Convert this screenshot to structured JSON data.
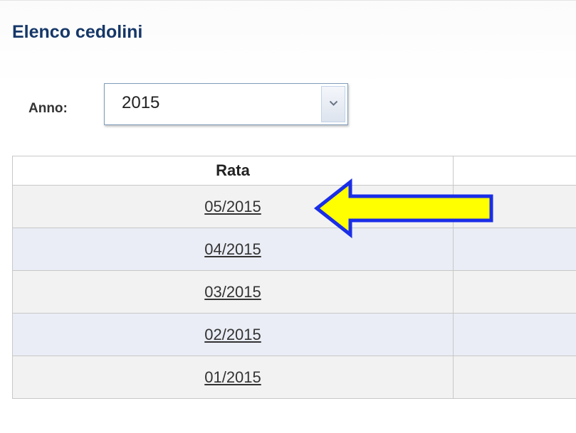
{
  "page": {
    "title": "Elenco cedolini"
  },
  "filter": {
    "year_label": "Anno:",
    "year_value": "2015"
  },
  "table": {
    "columns": [
      "Rata",
      ""
    ],
    "rows": [
      {
        "rata": "05/2015",
        "extra": ""
      },
      {
        "rata": "04/2015",
        "extra": ""
      },
      {
        "rata": "03/2015",
        "extra": ""
      },
      {
        "rata": "02/2015",
        "extra": ""
      },
      {
        "rata": "01/2015",
        "extra": ""
      }
    ]
  },
  "annotation": {
    "arrow_icon": "left-arrow-icon",
    "arrow_fill": "#ffff00",
    "arrow_stroke": "#1a2ee8"
  },
  "colors": {
    "title": "#163768",
    "row_odd": "#f2f2f2",
    "row_even": "#eaedf5",
    "border": "#c8c8c8"
  }
}
